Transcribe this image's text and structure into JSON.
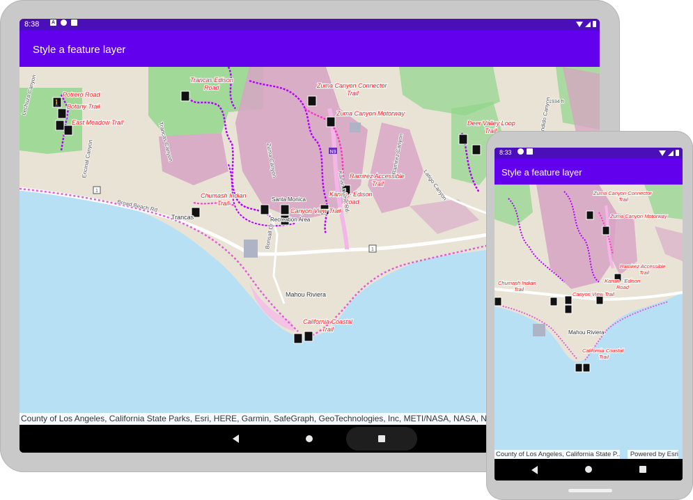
{
  "tablet": {
    "status_time": "8:38",
    "status_icons": [
      "a-icon",
      "data-saver-icon",
      "sim-card-icon"
    ],
    "app_title": "Style a feature layer",
    "attribution": "County of Los Angeles, California State Parks, Esri, HERE, Garmin, SafeGraph, GeoTechnologies, Inc, METI/NASA, NASA, NGA,"
  },
  "phone": {
    "status_time": "8:33",
    "status_icons": [
      "data-saver-icon",
      "sim-card-icon"
    ],
    "app_title": "Style a feature layer",
    "attribution": "County of Los Angeles, California State P...",
    "powered_by": "Powered by Esri"
  },
  "map": {
    "trail_labels": {
      "potrero_road": "Potrero Road",
      "botany_trail": "Botany Trail",
      "east_meadow_trail": "East Meadow Trail",
      "trancas_edison_road_1": "Trancas Edison",
      "trancas_edison_road_2": "Road",
      "zuma_connector_1": "Zuma Canyon Connector",
      "zuma_connector_2": "Trail",
      "zuma_motorway": "Zuma Canyon Motorway",
      "deer_valley_1": "Deer Valley Loop",
      "deer_valley_2": "Trail",
      "ramirez_1": "Ramirez Accessible",
      "ramirez_2": "Trail",
      "kanan_edison_1": "Kanan - Edison",
      "kanan_edison_2": "Road",
      "chumash_1": "Chumash Indian",
      "chumash_2": "Trail",
      "canyon_view": "Canyon View Trail",
      "coastal_1": "California Coastal",
      "coastal_2": "Trail"
    },
    "place_labels": {
      "trancas": "Trancas",
      "santa_monica": "Santa Monica",
      "mahou_riviera": "Mahou Riviera",
      "recreation_area": "Recreation Area"
    },
    "road_labels": {
      "broad_beach": "Broad Beach Rd",
      "route_1": "1",
      "n9": "N9",
      "bonsall": "Bonsall Dr",
      "encinal": "Encinal Canyon",
      "zuma_canyon": "Zuma Canyon",
      "kanan": "Kanan Dume Rd",
      "ramirez": "Ramirez Canyon",
      "latigo": "Latigo Canyon",
      "escondido": "Escondido Canyon",
      "trancas_canyon": "Trancas Canyon",
      "lechuza": "Lechuza Canyon",
      "elev_1934": "1934 ft"
    }
  },
  "colors": {
    "statusbar": "#4a0fb8",
    "appbar": "#6200ee",
    "ocean": "#b8e0f5",
    "land": "#e9e3d6",
    "park_green": "#8fd68a",
    "park_pink": "#d7a3c4",
    "trail": "#d418e8",
    "trail_label": "#ff1a1a"
  }
}
